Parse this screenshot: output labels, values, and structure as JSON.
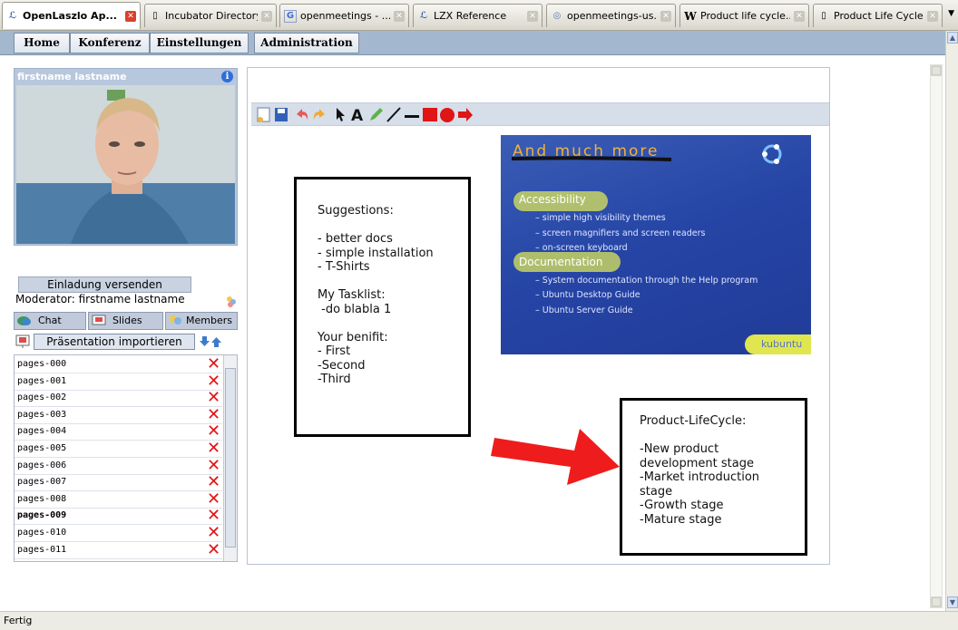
{
  "browser": {
    "tabs": [
      {
        "label": "OpenLaszlo Ap...",
        "active": true
      },
      {
        "label": "Incubator Directory"
      },
      {
        "label": "openmeetings - ..."
      },
      {
        "label": "LZX Reference"
      },
      {
        "label": "openmeetings-us..."
      },
      {
        "label": "Product life cycle..."
      },
      {
        "label": "Product Life Cycle"
      }
    ],
    "status": "Fertig"
  },
  "menu": {
    "home": "Home",
    "conference": "Konferenz",
    "settings": "Einstellungen",
    "admin": "Administration"
  },
  "video": {
    "user": "firstname lastname"
  },
  "sidebar": {
    "invite": "Einladung versenden",
    "moderator": "Moderator: firstname lastname",
    "tabs": {
      "chat": "Chat",
      "slides": "Slides",
      "members": "Members"
    },
    "import": "Präsentation importieren",
    "files": [
      "pages-000",
      "pages-001",
      "pages-002",
      "pages-003",
      "pages-004",
      "pages-005",
      "pages-006",
      "pages-007",
      "pages-008",
      "pages-009",
      "pages-010",
      "pages-011"
    ],
    "selected_file": "pages-009"
  },
  "whiteboard": {
    "note1": "Suggestions:\n\n- better docs\n- simple installation\n- T-Shirts\n\nMy Tasklist:\n -do blabla 1\n\nYour benifit:\n- First\n-Second\n-Third",
    "note2": "Product-LifeCycle:\n\n-New product\ndevelopment stage\n-Market introduction\nstage\n-Growth stage\n-Mature stage",
    "slide": {
      "title": "And much more",
      "h1": "Accessibility",
      "s1": "– simple high visibility themes",
      "s2": "– screen magnifiers and screen readers",
      "s3": "– on-screen keyboard",
      "h2": "Documentation",
      "s4": "– System documentation through the Help program",
      "s5": "– Ubuntu Desktop Guide",
      "s6": "– Ubuntu Server Guide",
      "logo": "kubuntu"
    }
  },
  "colors": {
    "menubar": "#a3b8cf",
    "arrow": "#ee1c1c",
    "delete": "#e01515"
  }
}
